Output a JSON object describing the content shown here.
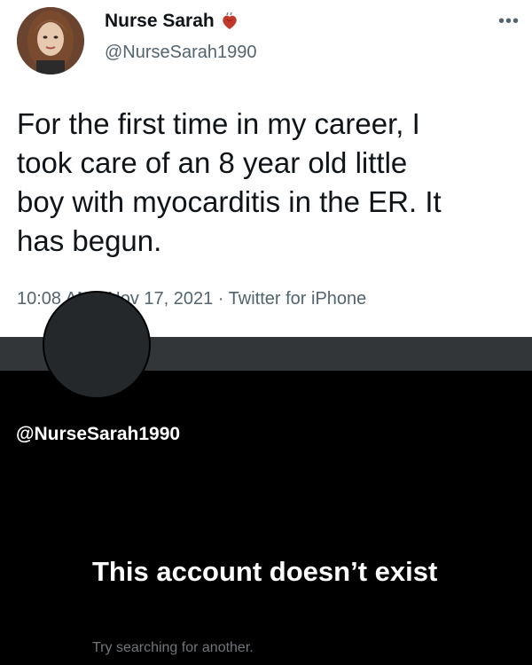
{
  "tweet": {
    "display_name": "Nurse Sarah",
    "handle": "@NurseSarah1990",
    "more_icon": "more-options-icon",
    "name_icon": "anatomical-heart-icon",
    "text": "For the first time in my career, I\ntook care of an 8 year old little\nboy with myocarditis in the ER.  It\nhas begun.",
    "meta": "10:08 AM · Nov 17, 2021 · Twitter for iPhone"
  },
  "profile": {
    "handle": "@NurseSarah1990",
    "empty_title": "This account doesn’t exist",
    "empty_subtitle": "Try searching for another."
  },
  "colors": {
    "tweet_bg": "#ffffff",
    "text_primary": "#0f1419",
    "text_secondary": "#536471",
    "dark_bg": "#000000",
    "banner": "#323639",
    "muted_dark": "#71767b"
  }
}
